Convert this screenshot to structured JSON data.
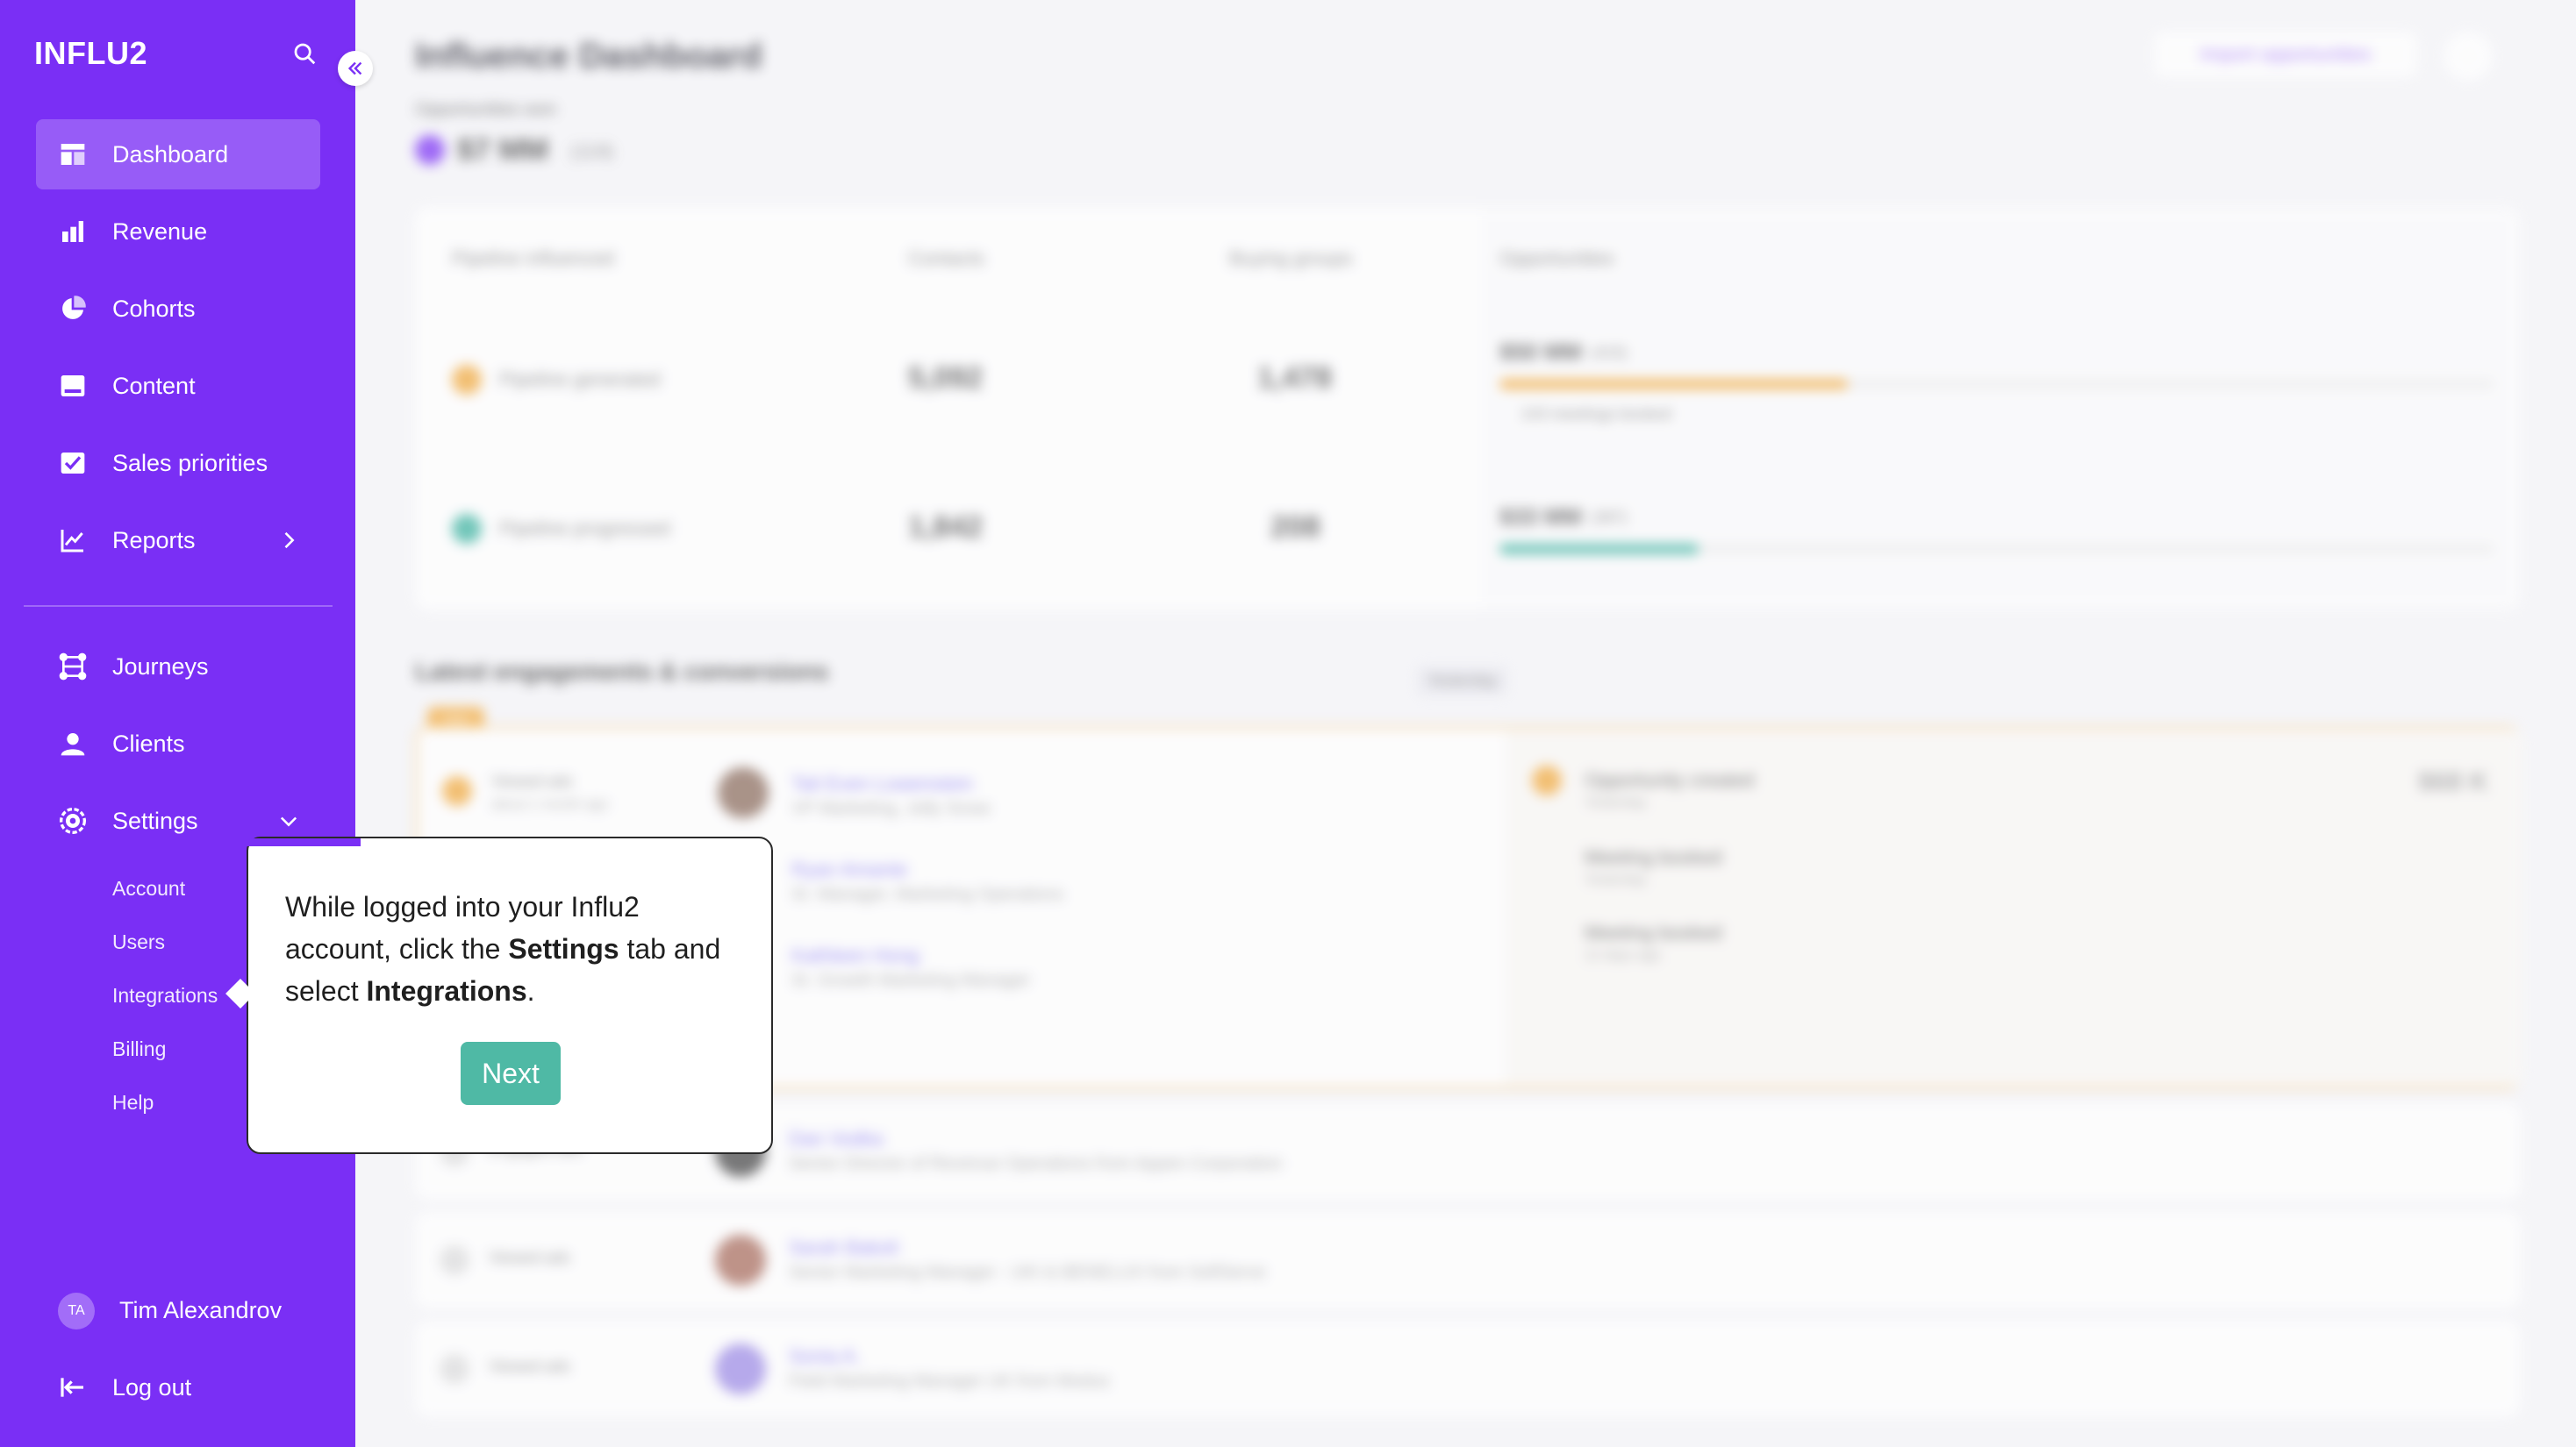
{
  "app": {
    "logo": "INFLU2"
  },
  "sidebar": {
    "nav": [
      {
        "label": "Dashboard",
        "icon": "dashboard-icon",
        "active": true
      },
      {
        "label": "Revenue",
        "icon": "bar-chart-icon"
      },
      {
        "label": "Cohorts",
        "icon": "pie-chart-icon"
      },
      {
        "label": "Content",
        "icon": "content-icon"
      },
      {
        "label": "Sales priorities",
        "icon": "checkbox-icon"
      },
      {
        "label": "Reports",
        "icon": "line-chart-icon"
      },
      {
        "label": "Journeys",
        "icon": "journeys-icon"
      },
      {
        "label": "Clients",
        "icon": "person-icon"
      },
      {
        "label": "Settings",
        "icon": "gear-icon"
      }
    ],
    "settings_sub": [
      "Account",
      "Users",
      "Integrations",
      "Billing",
      "Help"
    ],
    "user": {
      "initials": "TA",
      "name": "Tim Alexandrov"
    },
    "logout": "Log out"
  },
  "main": {
    "title": "Influence Dashboard",
    "import_button": "Import opportunities",
    "opportunities_label": "Opportunities won",
    "opportunities_value": "$7 MM",
    "opportunities_count": "(119)",
    "table": {
      "headers": [
        "Pipeline influenced",
        "Contacts",
        "Buying groups",
        "Opportunities"
      ],
      "rows": [
        {
          "label": "Pipeline generated",
          "contacts": "5,092",
          "groups": "1,478",
          "value": "$50 MM",
          "count": "(415)",
          "note": "143 meetings booked",
          "color": "#f2a93b",
          "progress": 0.35
        },
        {
          "label": "Pipeline progressed",
          "contacts": "1,842",
          "groups": "208",
          "value": "$33 MM",
          "count": "(387)",
          "note": "",
          "color": "#3bb3a0",
          "progress": 0.2
        }
      ]
    },
    "engagements_title": "Latest engagements & conversions",
    "engagements_tag": "Yesterday",
    "badge": "new",
    "highlight": {
      "event": "Viewed ads",
      "time": "about 1 month ago",
      "contacts": [
        {
          "name": "Tali Even Lowenstein",
          "role": "VP Marketing, Jolly Snow"
        },
        {
          "name": "Ryan Amante",
          "role": "Sr. Manager, Marketing Operations"
        },
        {
          "name": "Kathleen Hong",
          "role": "Sr. Growth Marketing Manager"
        }
      ],
      "timeline": [
        {
          "label": "Opportunity created",
          "sub": "Yesterday"
        },
        {
          "label": "Meeting booked",
          "sub": "Yesterday"
        },
        {
          "label": "Meeting booked",
          "sub": "12 days ago"
        }
      ],
      "amount": "$68 K"
    },
    "rows": [
      {
        "event": "Engaged ads",
        "name": "Dan Vodka",
        "role": "Senior Director of Revenue Operations from Appen Corporation"
      },
      {
        "event": "Viewed ads",
        "name": "Sarah Bakoli",
        "role": "Senior Marketing Manager - UKI & BENELUX from SoftServe"
      },
      {
        "event": "Viewed ads",
        "name": "Sonia A.",
        "role": "Field Marketing Manager UK from Modus"
      }
    ]
  },
  "tooltip": {
    "text_1": "While logged into your Influ2 account, click the ",
    "bold_1": "Settings",
    "text_2": " tab and select ",
    "bold_2": "Integrations",
    "text_3": ".",
    "button": "Next"
  }
}
